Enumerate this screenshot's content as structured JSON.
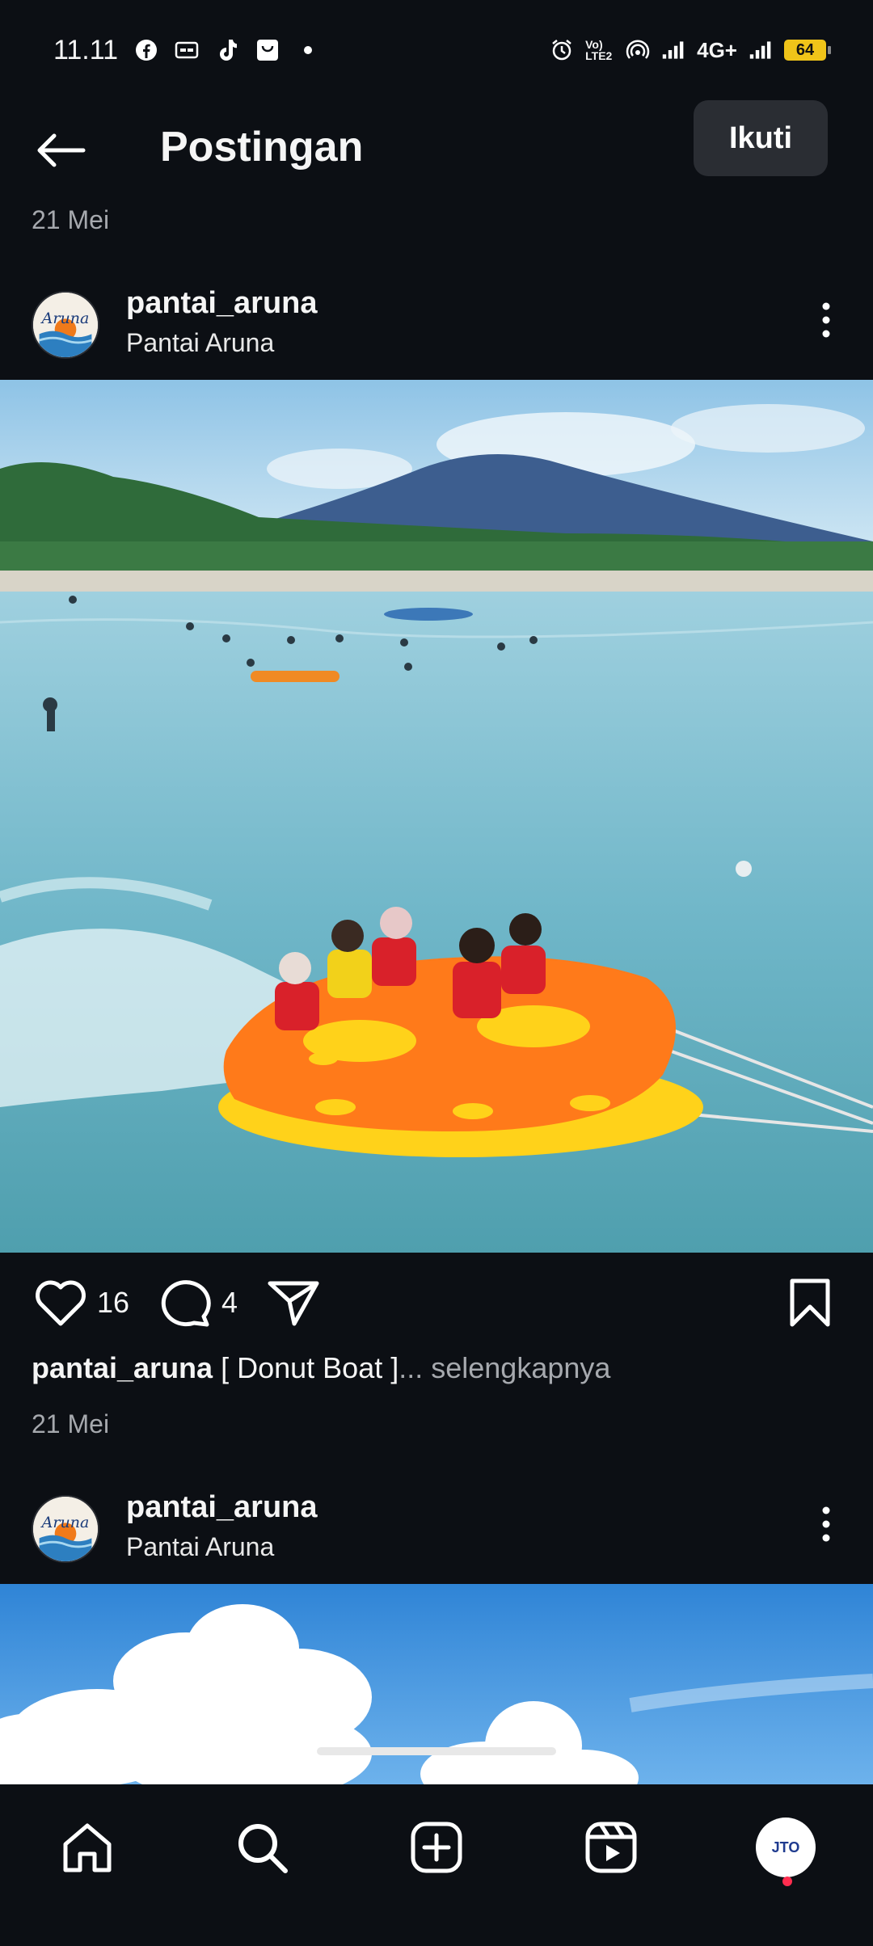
{
  "status_bar": {
    "time": "11.11",
    "left_icons": [
      "facebook-icon",
      "caption-icon",
      "tiktok-icon",
      "shopping-bag-icon",
      "dot-icon"
    ],
    "right_icons": [
      "alarm-icon",
      "volte-icon",
      "hotspot-icon",
      "signal-icon",
      "signal-icon"
    ],
    "network_label": "4G+",
    "volte_label": "Vo) LTE2",
    "battery_level": "64"
  },
  "header": {
    "title": "Postingan",
    "back_icon": "arrow-left-icon",
    "follow_label": "Ikuti"
  },
  "feed": {
    "top_date": "21 Mei",
    "posts": [
      {
        "username": "pantai_aruna",
        "location": "Pantai Aruna",
        "avatar_text": "Aruna",
        "likes": "16",
        "comments": "4",
        "caption_user": "pantai_aruna",
        "caption_text": "[ Donut Boat ]",
        "caption_more": "... selengkapnya",
        "date": "21 Mei"
      },
      {
        "username": "pantai_aruna",
        "location": "Pantai Aruna",
        "avatar_text": "Aruna"
      }
    ]
  },
  "bottom_nav": {
    "items": [
      "home-icon",
      "search-icon",
      "create-icon",
      "reels-icon",
      "profile-avatar"
    ],
    "profile_text": "JTO"
  },
  "colors": {
    "background": "#0c0f14",
    "secondary_text": "#a6a9ae",
    "button_bg": "#2a2d33",
    "boat_orange": "#ff7a1a",
    "boat_yellow": "#ffd21a",
    "notification": "#ff2d4f"
  }
}
